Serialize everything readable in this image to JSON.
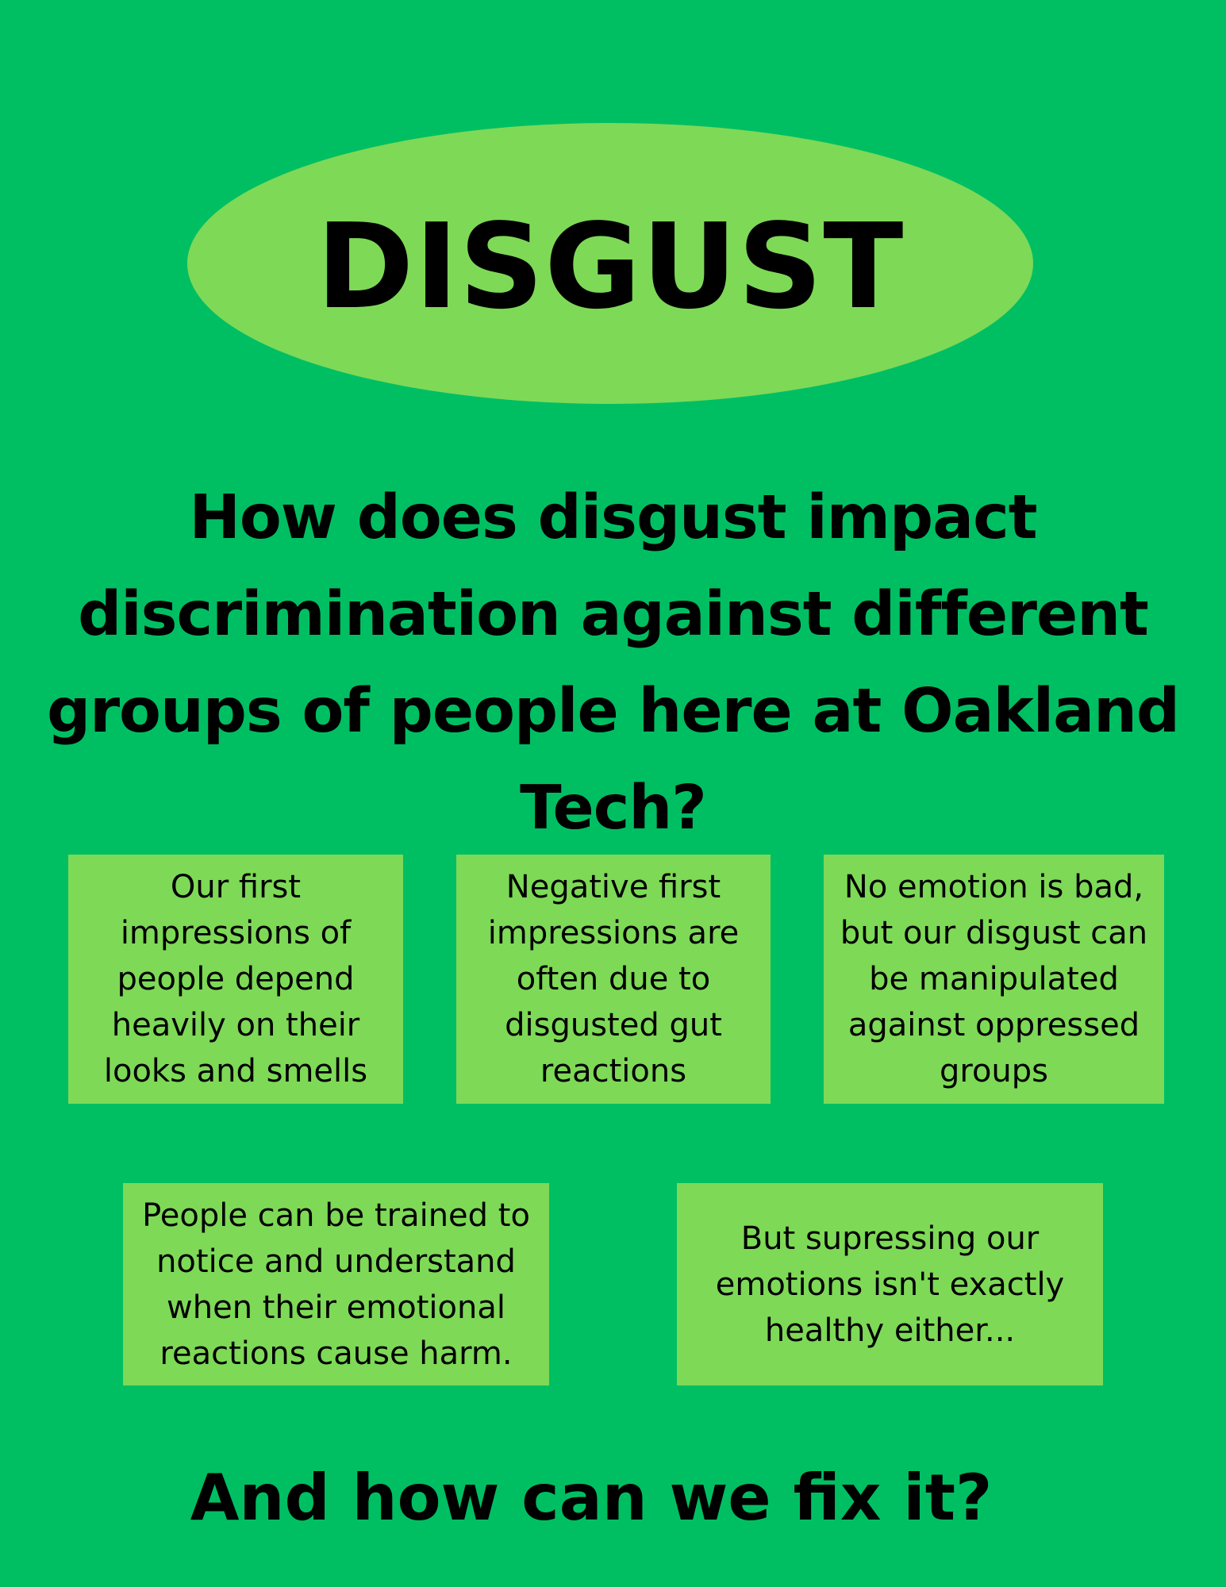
{
  "title": "DISGUST",
  "question": "How does disgust impact discrimination against different groups of people here at Oakland Tech?",
  "boxes": [
    {
      "text": "Our first impressions of people depend heavily on their looks and smells"
    },
    {
      "text": "Negative first impressions are often due to disgusted gut reactions"
    },
    {
      "text": "No emotion is bad, but our disgust can be manipulated against oppressed groups"
    },
    {
      "text": "People can be trained to notice and understand when their emotional reactions cause harm."
    },
    {
      "text": "But supressing our emotions isn't exactly healthy either..."
    }
  ],
  "closing": "And how can we fix it?",
  "colors": {
    "background": "#00bf63",
    "accent": "#7ed957",
    "text": "#000000"
  }
}
